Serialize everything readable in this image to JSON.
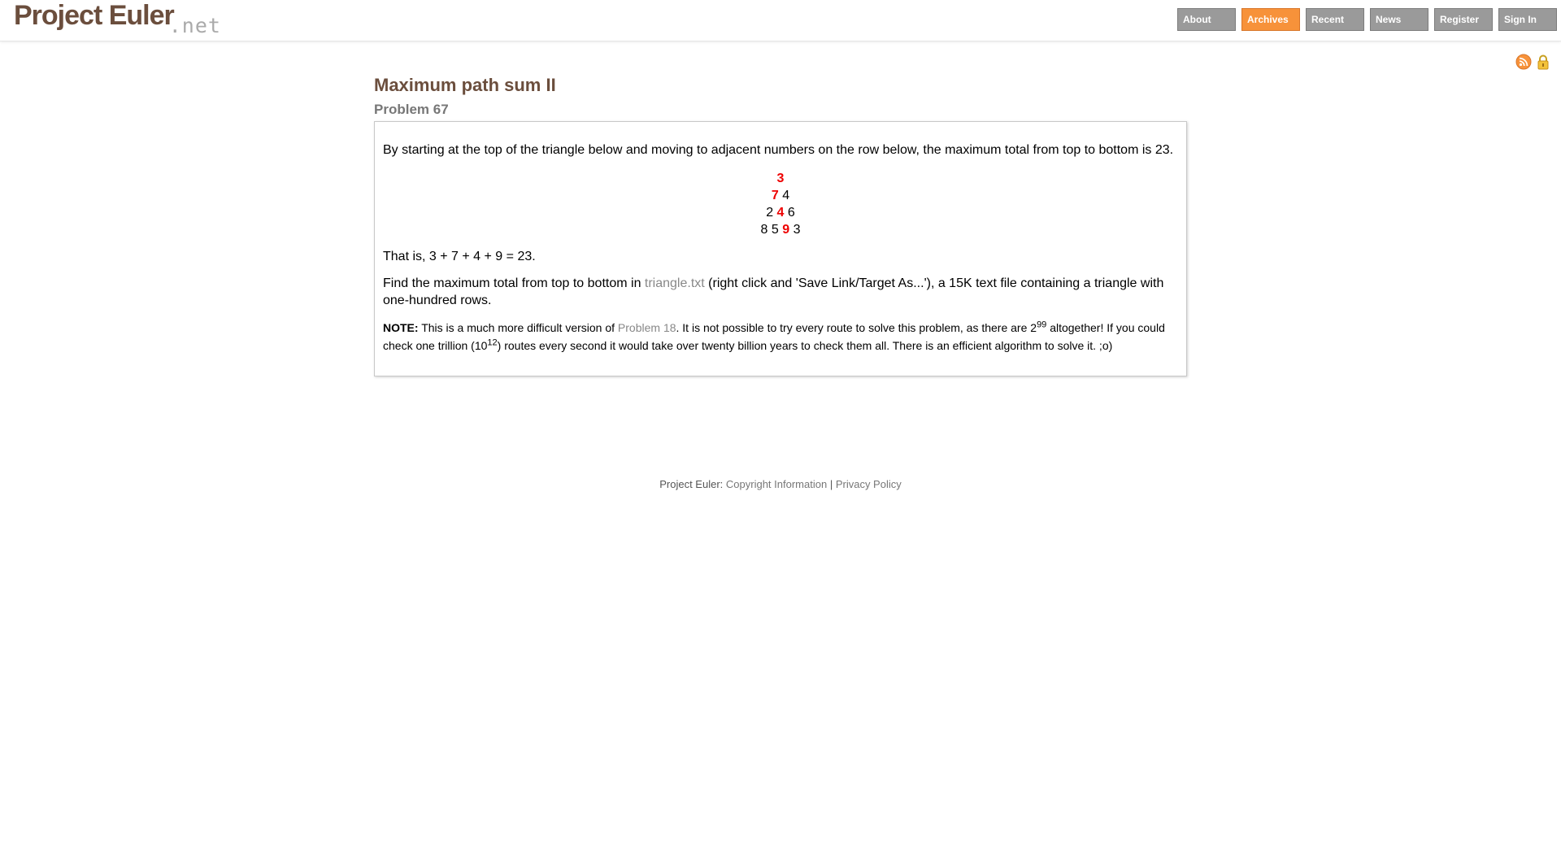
{
  "site": {
    "logo_main": "Project Euler",
    "logo_net": ".net"
  },
  "nav": {
    "items": [
      {
        "label": "About",
        "active": false
      },
      {
        "label": "Archives",
        "active": true
      },
      {
        "label": "Recent",
        "active": false
      },
      {
        "label": "News",
        "active": false
      },
      {
        "label": "Register",
        "active": false
      },
      {
        "label": "Sign In",
        "active": false
      }
    ]
  },
  "icons": {
    "rss": "rss-icon",
    "lock": "lock-icon",
    "accent": "#f7923a"
  },
  "problem": {
    "title": "Maximum path sum II",
    "subtitle": "Problem 67",
    "intro": "By starting at the top of the triangle below and moving to adjacent numbers on the row below, the maximum total from top to bottom is 23.",
    "triangle": {
      "row1": {
        "a": "3"
      },
      "row2": {
        "a": "7",
        "b": "4"
      },
      "row3": {
        "a": "2",
        "b": "4",
        "c": "6"
      },
      "row4": {
        "a": "8",
        "b": "5",
        "c": "9",
        "d": "3"
      }
    },
    "that_is": "That is, 3 + 7 + 4 + 9 = 23.",
    "find_pre": "Find the maximum total from top to bottom in ",
    "find_link": "triangle.txt",
    "find_post": " (right click and 'Save Link/Target As...'), a 15K text file containing a triangle with one-hundred rows.",
    "note_label": "NOTE:",
    "note_a": " This is a much more difficult version of ",
    "note_link": "Problem 18",
    "note_b": ". It is not possible to try every route to solve this problem, as there are 2",
    "note_exp1": "99",
    "note_c": " altogether! If you could check one trillion (10",
    "note_exp2": "12",
    "note_d": ") routes every second it would take over twenty billion years to check them all. There is an efficient algorithm to solve it. ;o)"
  },
  "footer": {
    "label": "Project Euler:",
    "copyright": "Copyright Information",
    "separator": "|",
    "privacy": "Privacy Policy"
  }
}
